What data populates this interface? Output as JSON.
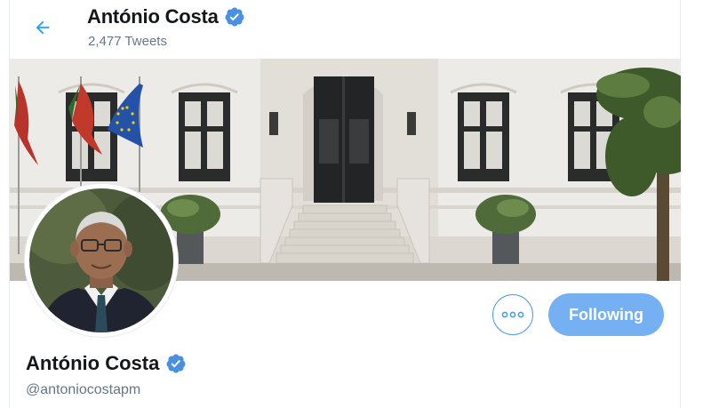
{
  "header": {
    "name": "António Costa",
    "tweet_count": "2,477 Tweets"
  },
  "profile": {
    "name": "António Costa",
    "handle": "@antoniocostapm",
    "verified": true
  },
  "actions": {
    "more_icon": "more-horizontal-icon",
    "follow_label": "Following"
  },
  "colors": {
    "accent": "#1da1f2",
    "following_button": "#74b0f2",
    "verified_badge": "#4a90e2",
    "secondary_text": "#657786"
  }
}
